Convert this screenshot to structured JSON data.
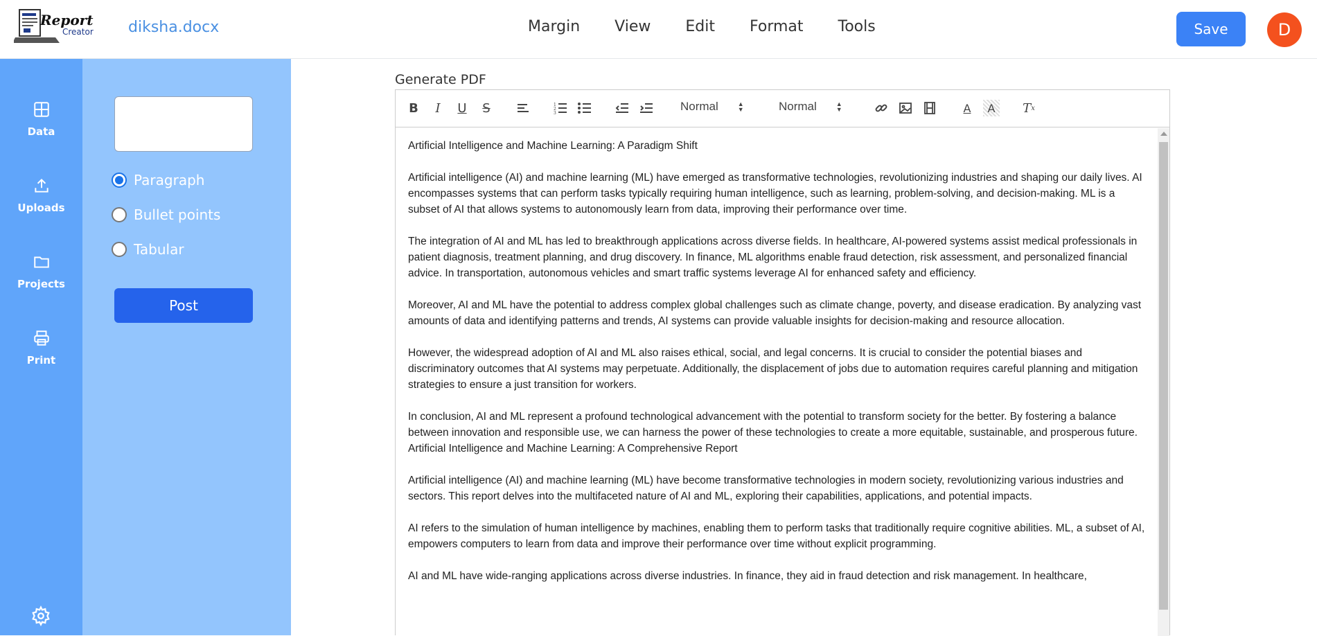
{
  "header": {
    "logo_text": "Report Creator",
    "filename": "diksha.docx",
    "menu": [
      "Margin",
      "View",
      "Edit",
      "Format",
      "Tools"
    ],
    "save_label": "Save",
    "avatar_initial": "D"
  },
  "rail": {
    "items": [
      {
        "label": "Data",
        "icon": "grid-icon"
      },
      {
        "label": "Uploads",
        "icon": "upload-icon"
      },
      {
        "label": "Projects",
        "icon": "folder-icon"
      },
      {
        "label": "Print",
        "icon": "printer-icon"
      }
    ],
    "settings_icon": "gear-icon"
  },
  "panel": {
    "input_value": "",
    "options": [
      {
        "label": "Paragraph",
        "checked": true
      },
      {
        "label": "Bullet points",
        "checked": false
      },
      {
        "label": "Tabular",
        "checked": false
      }
    ],
    "post_label": "Post"
  },
  "editor": {
    "label": "Generate PDF",
    "toolbar": {
      "size_select": "Normal",
      "heading_select": "Normal"
    },
    "paragraphs": [
      "Artificial Intelligence and Machine Learning: A Paradigm Shift",
      "Artificial intelligence (AI) and machine learning (ML) have emerged as transformative technologies, revolutionizing industries and shaping our daily lives. AI encompasses systems that can perform tasks typically requiring human intelligence, such as learning, problem-solving, and decision-making. ML is a subset of AI that allows systems to autonomously learn from data, improving their performance over time.",
      "The integration of AI and ML has led to breakthrough applications across diverse fields. In healthcare, AI-powered systems assist medical professionals in patient diagnosis, treatment planning, and drug discovery. In finance, ML algorithms enable fraud detection, risk assessment, and personalized financial advice. In transportation, autonomous vehicles and smart traffic systems leverage AI for enhanced safety and efficiency.",
      "Moreover, AI and ML have the potential to address complex global challenges such as climate change, poverty, and disease eradication. By analyzing vast amounts of data and identifying patterns and trends, AI systems can provide valuable insights for decision-making and resource allocation.",
      "However, the widespread adoption of AI and ML also raises ethical, social, and legal concerns. It is crucial to consider the potential biases and discriminatory outcomes that AI systems may perpetuate. Additionally, the displacement of jobs due to automation requires careful planning and mitigation strategies to ensure a just transition for workers.",
      "In conclusion, AI and ML represent a profound technological advancement with the potential to transform society for the better. By fostering a balance between innovation and responsible use, we can harness the power of these technologies to create a more equitable, sustainable, and prosperous future.",
      "Artificial Intelligence and Machine Learning: A Comprehensive Report",
      "Artificial intelligence (AI) and machine learning (ML) have become transformative technologies in modern society, revolutionizing various industries and sectors. This report delves into the multifaceted nature of AI and ML, exploring their capabilities, applications, and potential impacts.",
      "AI refers to the simulation of human intelligence by machines, enabling them to perform tasks that traditionally require cognitive abilities. ML, a subset of AI, empowers computers to learn from data and improve their performance over time without explicit programming.",
      "AI and ML have wide-ranging applications across diverse industries. In finance, they aid in fraud detection and risk management. In healthcare,"
    ]
  },
  "colors": {
    "rail": "#60a5fa",
    "panel": "#93c5fd",
    "save": "#3b82f6",
    "post": "#2563eb",
    "avatar": "#f4511e",
    "filename": "#4a90e2"
  }
}
